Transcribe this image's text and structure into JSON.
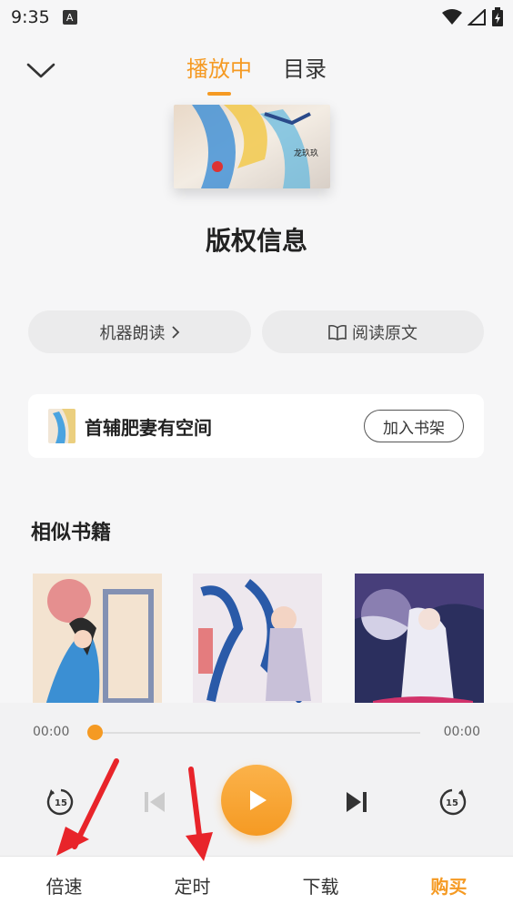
{
  "status_bar": {
    "time": "9:35",
    "badge": "A"
  },
  "nav": {
    "tabs": [
      {
        "label": "播放中"
      },
      {
        "label": "目录"
      }
    ]
  },
  "book": {
    "title": "版权信息",
    "cover_caption": "龙玖玖"
  },
  "actions": {
    "machine_read": "机器朗读",
    "read_original": "阅读原文"
  },
  "book_card": {
    "title": "首辅肥妻有空间",
    "shelf_button": "加入书架"
  },
  "similar": {
    "title": "相似书籍"
  },
  "player": {
    "current_time": "00:00",
    "total_time": "00:00",
    "progress": 0,
    "skip_seconds": "15"
  },
  "bottom_bar": {
    "speed": "倍速",
    "timer": "定时",
    "download": "下载",
    "buy": "购买"
  },
  "colors": {
    "accent": "#f59a23",
    "arrow": "#e8242a"
  }
}
